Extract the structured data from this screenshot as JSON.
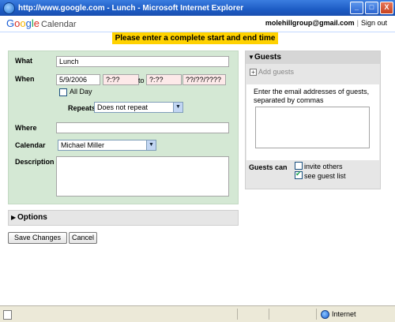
{
  "window": {
    "title": "http://www.google.com - Lunch - Microsoft Internet Explorer",
    "minimize": "_",
    "maximize": "□",
    "close": "X"
  },
  "header": {
    "logo_letters": [
      "G",
      "o",
      "o",
      "g",
      "l",
      "e"
    ],
    "logo_product": "Calendar",
    "email": "molehillgroup@gmail.com",
    "separator": "|",
    "signout": "Sign out"
  },
  "warning": "Please enter a complete start and end time",
  "form": {
    "what_label": "What",
    "what_value": "Lunch",
    "when_label": "When",
    "start_date": "5/9/2006",
    "start_time": "?:??",
    "to_label": "to",
    "end_time": "?:??",
    "end_date": "??/??/????",
    "allday_label": "All Day",
    "repeats_label": "Repeats:",
    "repeats_value": "Does not repeat",
    "where_label": "Where",
    "where_value": "",
    "calendar_label": "Calendar",
    "calendar_value": "Michael Miller",
    "description_label": "Description",
    "description_value": ""
  },
  "options": {
    "label": "Options",
    "arrow": "▶"
  },
  "buttons": {
    "save": "Save Changes",
    "cancel": "Cancel"
  },
  "guests": {
    "title": "Guests",
    "arrow": "▼",
    "add_guests": "Add guests",
    "plus": "+",
    "instructions": "Enter the email addresses of guests, separated by commas",
    "guests_can_label": "Guests can",
    "invite_others": "invite others",
    "invite_others_checked": false,
    "see_guest_list": "see guest list",
    "see_guest_list_checked": true
  },
  "statusbar": {
    "zone": "Internet"
  },
  "colors": {
    "form_bg": "#d4e8d4",
    "warning_bg": "#ffd200",
    "error_field_bg": "#fde9e9",
    "panel_gray": "#e6e6e6"
  }
}
